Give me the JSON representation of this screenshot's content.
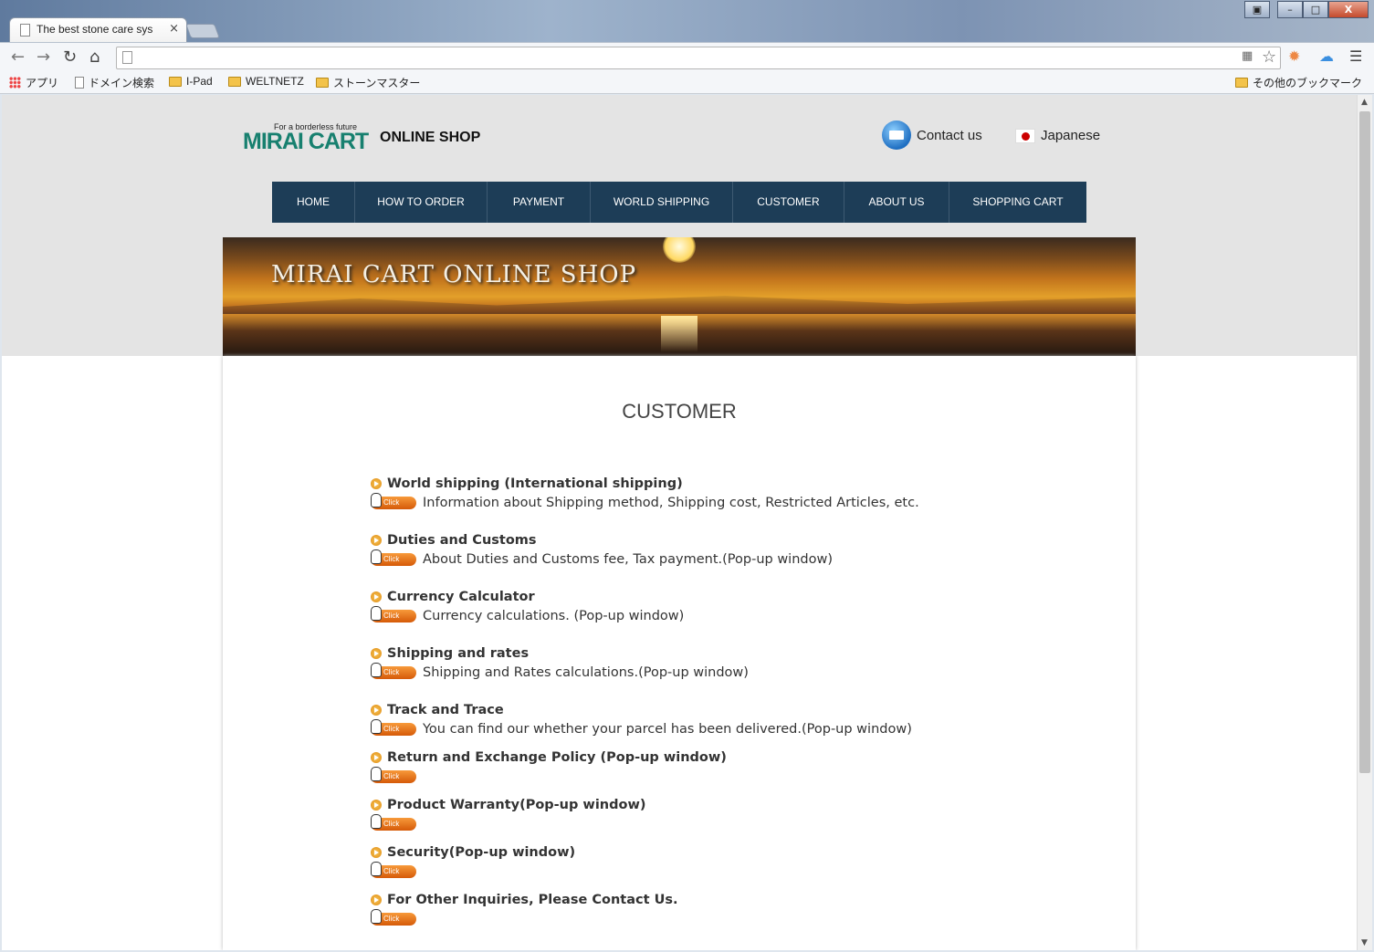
{
  "browser": {
    "tab_title": "The best stone care sys",
    "tab_close": "×",
    "win_buttons": [
      "▣",
      "–",
      "□",
      "X"
    ],
    "bookmarks": [
      "アプリ",
      "ドメイン検索",
      "I-Pad",
      "WELTNETZ",
      "ストーンマスター"
    ],
    "other_bookmarks": "その他のブックマーク"
  },
  "header": {
    "logo_tagline": "For a borderless future",
    "logo_name": "MIRAI CART",
    "shop_label": "ONLINE SHOP",
    "contact": "Contact us",
    "language": "Japanese"
  },
  "nav": [
    "HOME",
    "HOW TO ORDER",
    "PAYMENT",
    "WORLD SHIPPING",
    "CUSTOMER",
    "ABOUT US",
    "SHOPPING CART"
  ],
  "banner": {
    "title": "MIRAI CART ONLINE SHOP"
  },
  "page": {
    "title": "CUSTOMER",
    "click_label": "Click",
    "items": [
      {
        "heading": "World shipping (International shipping)",
        "desc": "Information about Shipping method, Shipping cost, Restricted Articles, etc."
      },
      {
        "heading": "Duties and Customs",
        "desc": "About Duties and Customs fee, Tax payment.(Pop-up window)"
      },
      {
        "heading": "Currency Calculator",
        "desc": "Currency calculations. (Pop-up window)"
      },
      {
        "heading": "Shipping and rates",
        "desc": "Shipping and Rates calculations.(Pop-up window)"
      },
      {
        "heading": "Track and Trace",
        "desc": "You can find our whether your parcel has been delivered.(Pop-up window)"
      },
      {
        "heading": "Return and Exchange Policy (Pop-up window)",
        "desc": ""
      },
      {
        "heading": "Product Warranty(Pop-up window)",
        "desc": ""
      },
      {
        "heading": "Security(Pop-up window)",
        "desc": ""
      },
      {
        "heading": "For Other Inquiries, Please Contact Us.",
        "desc": ""
      }
    ]
  }
}
